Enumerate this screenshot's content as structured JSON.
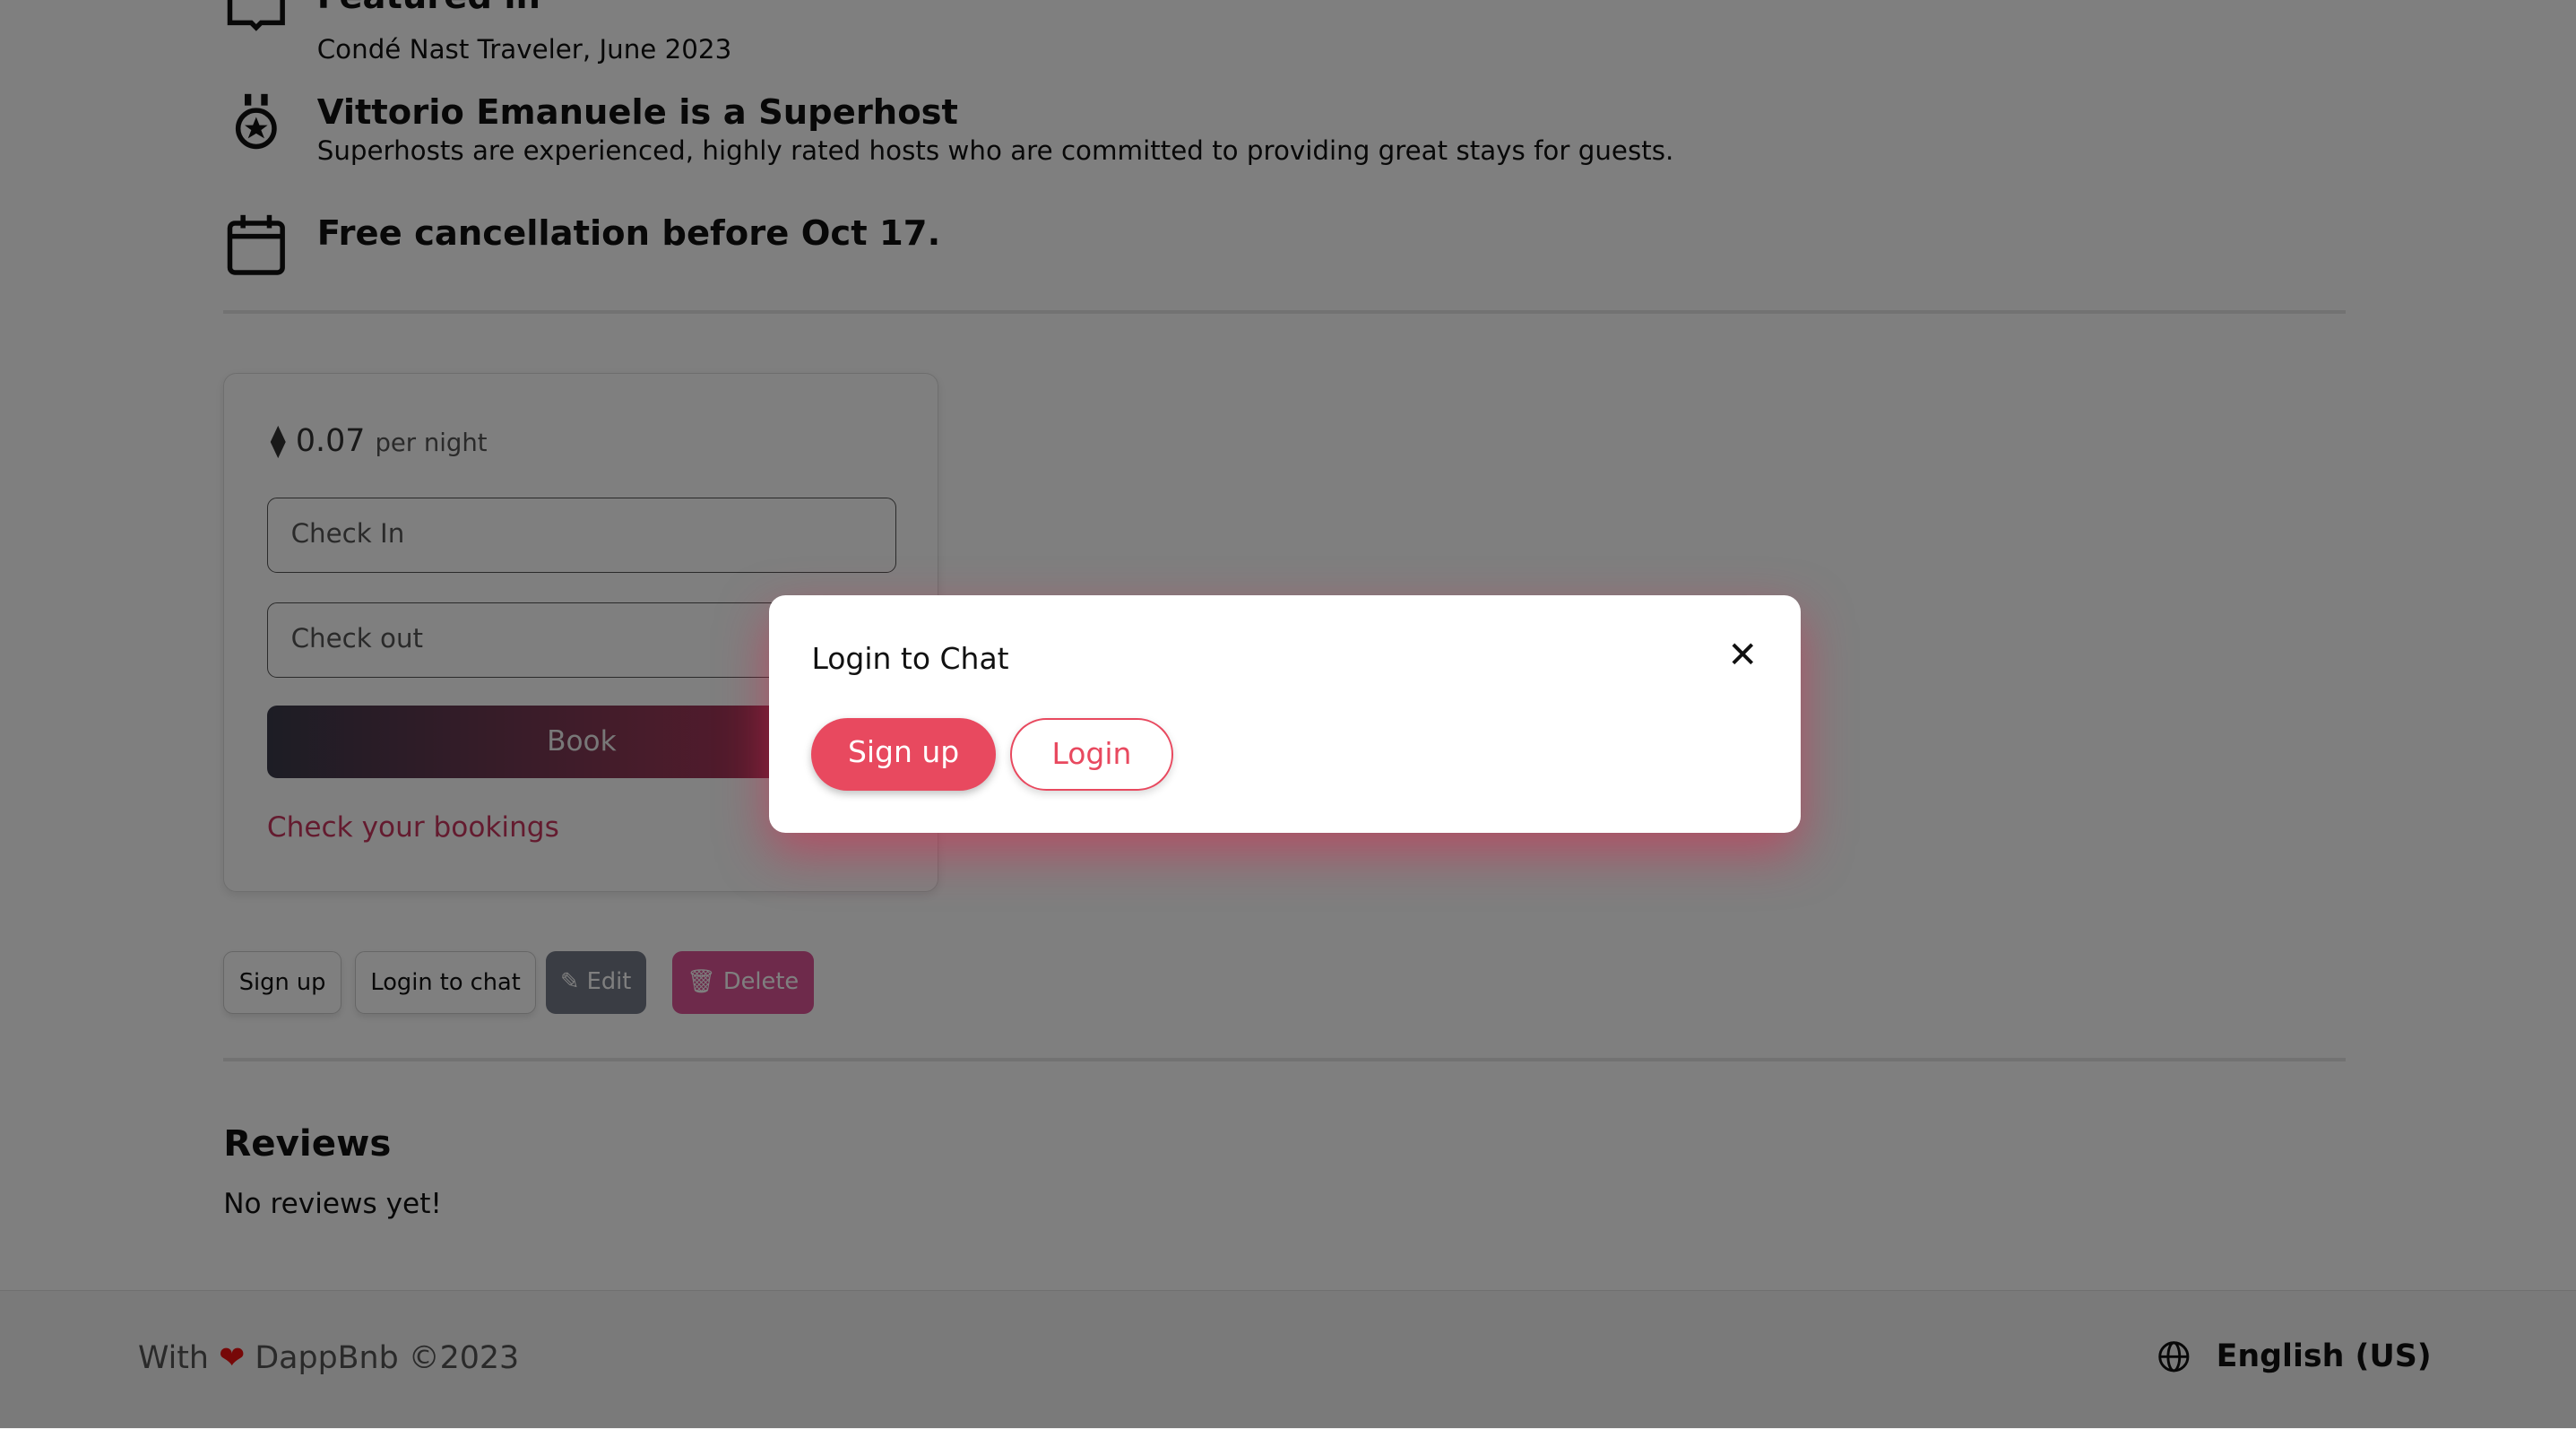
{
  "features": [
    {
      "icon": "book-open-icon",
      "title": "Featured in",
      "subtitle": "Condé Nast Traveler, June 2023"
    },
    {
      "icon": "medal-icon",
      "title": "Vittorio Emanuele is a Superhost",
      "subtitle": "Superhosts are experienced, highly rated hosts who are committed to providing great stays for guests."
    },
    {
      "icon": "calendar-icon",
      "title": "Free cancellation before Oct 17.",
      "subtitle": ""
    }
  ],
  "booking": {
    "price": "0.07",
    "price_unit": "per night",
    "checkin_placeholder": "Check In",
    "checkout_placeholder": "Check out",
    "book_label": "Book",
    "bookings_link": "Check your bookings"
  },
  "actions": {
    "signup": "Sign up",
    "login_chat": "Login to chat",
    "edit": "Edit",
    "delete": "Delete"
  },
  "reviews": {
    "title": "Reviews",
    "empty": "No reviews yet!"
  },
  "footer": {
    "prefix": "With",
    "brand": "DappBnb ©2023",
    "language": "English (US)"
  },
  "modal": {
    "title": "Login to Chat",
    "signup": "Sign up",
    "login": "Login"
  },
  "colors": {
    "accent": "#e8495f",
    "delete": "#dc5496"
  }
}
